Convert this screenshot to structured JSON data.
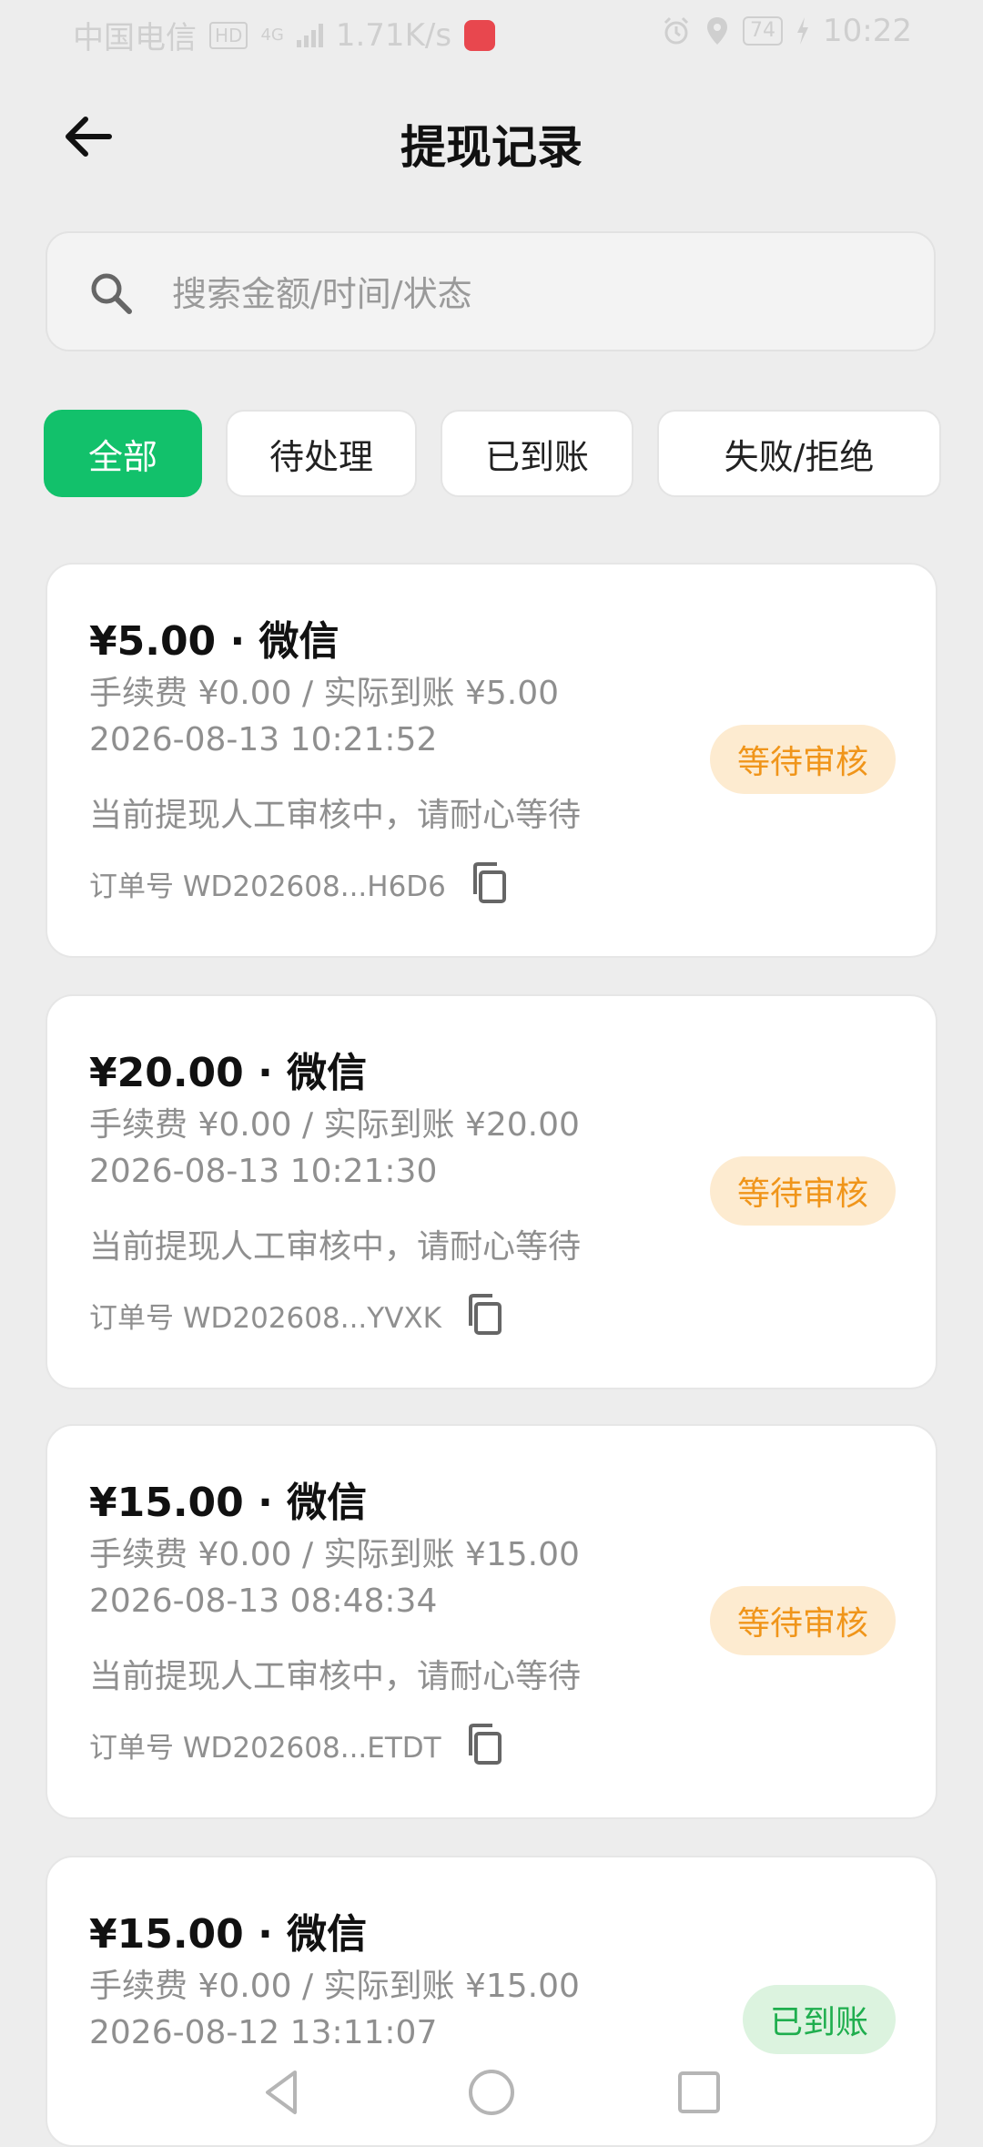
{
  "status_bar": {
    "carrier": "中国电信",
    "hd": "HD",
    "network": "4G",
    "speed": "1.71K/s",
    "battery": "74",
    "time": "10:22"
  },
  "header": {
    "title": "提现记录"
  },
  "search": {
    "placeholder": "搜索金额/时间/状态"
  },
  "tabs": [
    {
      "label": "全部",
      "active": true
    },
    {
      "label": "待处理",
      "active": false
    },
    {
      "label": "已到账",
      "active": false
    },
    {
      "label": "失败/拒绝",
      "active": false
    }
  ],
  "records": [
    {
      "amount": "¥5.00 · 微信",
      "fee": "手续费 ¥0.00 / 实际到账 ¥5.00",
      "time": "2026-08-13 10:21:52",
      "note": "当前提现人工审核中，请耐心等待",
      "order": "订单号 WD202608...H6D6",
      "status": "等待审核",
      "status_type": "pending"
    },
    {
      "amount": "¥20.00 · 微信",
      "fee": "手续费 ¥0.00 / 实际到账 ¥20.00",
      "time": "2026-08-13 10:21:30",
      "note": "当前提现人工审核中，请耐心等待",
      "order": "订单号 WD202608...YVXK",
      "status": "等待审核",
      "status_type": "pending"
    },
    {
      "amount": "¥15.00 · 微信",
      "fee": "手续费 ¥0.00 / 实际到账 ¥15.00",
      "time": "2026-08-13 08:48:34",
      "note": "当前提现人工审核中，请耐心等待",
      "order": "订单号 WD202608...ETDT",
      "status": "等待审核",
      "status_type": "pending"
    },
    {
      "amount": "¥15.00 · 微信",
      "fee": "手续费 ¥0.00 / 实际到账 ¥15.00",
      "time": "2026-08-12 13:11:07",
      "status": "已到账",
      "status_type": "done"
    }
  ],
  "colors": {
    "accent": "#12c16b",
    "pending_bg": "#fdebd0",
    "pending_text": "#f0951a",
    "done_bg": "#dcf3df",
    "done_text": "#1fae4e"
  }
}
